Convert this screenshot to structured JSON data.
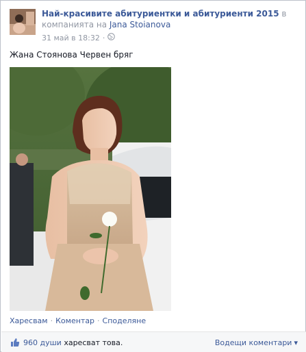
{
  "post": {
    "group_name": "Най-красивите абитуриентки и абитуриенти 2015",
    "in_company_of": "в компанията на",
    "author": "Jana Stoianova",
    "date": "31 май в 18:32",
    "privacy_separator": "·",
    "caption": "Жана Стоянова Червен бряг"
  },
  "actions": {
    "like": "Харесвам",
    "comment": "Коментар",
    "share": "Споделяне",
    "separator": "·"
  },
  "likes": {
    "count": "960 души",
    "suffix": "харесват това."
  },
  "comments": {
    "toggle_label": "Водещи коментари",
    "caret": "▾"
  },
  "colors": {
    "link": "#3b5998",
    "meta": "#9197a3",
    "border": "#bdc1c9",
    "footer_bg": "#f6f7f8"
  },
  "icons": [
    "group-avatar",
    "globe-icon",
    "thumbs-up-icon",
    "caret-down-icon"
  ]
}
